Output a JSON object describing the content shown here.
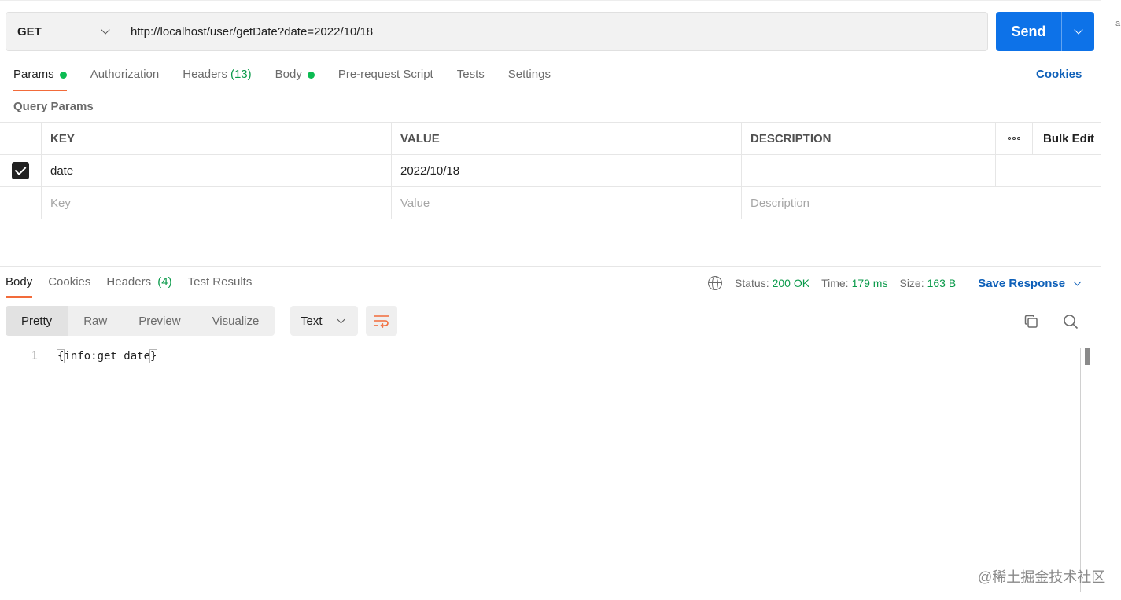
{
  "request": {
    "method": "GET",
    "url": "http://localhost/user/getDate?date=2022/10/18",
    "send_label": "Send"
  },
  "req_tabs": {
    "params": "Params",
    "authorization": "Authorization",
    "headers": "Headers",
    "headers_count": "(13)",
    "body": "Body",
    "pre_request": "Pre-request Script",
    "tests": "Tests",
    "settings": "Settings"
  },
  "cookies_label": "Cookies",
  "query_params_title": "Query Params",
  "params_table": {
    "headers": {
      "key": "KEY",
      "value": "VALUE",
      "description": "DESCRIPTION",
      "bulk_edit": "Bulk Edit"
    },
    "rows": [
      {
        "checked": true,
        "key": "date",
        "value": "2022/10/18",
        "description": ""
      }
    ],
    "placeholders": {
      "key": "Key",
      "value": "Value",
      "description": "Description"
    }
  },
  "response": {
    "tabs": {
      "body": "Body",
      "cookies": "Cookies",
      "headers": "Headers",
      "headers_count": "(4)",
      "test_results": "Test Results"
    },
    "status_label": "Status:",
    "status_value": "200 OK",
    "time_label": "Time:",
    "time_value": "179 ms",
    "size_label": "Size:",
    "size_value": "163 B",
    "save_response": "Save Response",
    "formats": {
      "pretty": "Pretty",
      "raw": "Raw",
      "preview": "Preview",
      "visualize": "Visualize"
    },
    "content_type": "Text",
    "body_lines": [
      {
        "number": "1",
        "open": "{",
        "text": "info:get date",
        "close": "}"
      }
    ]
  },
  "watermark": "@稀土掘金技术社区",
  "edge_glyph": "a",
  "colors": {
    "send_blue": "#0d72e8",
    "active_tab": "#f26b3a",
    "status_green": "#0a9a4a",
    "link_blue": "#0d5fb8"
  },
  "icons": [
    "chevron-down-icon",
    "checkbox-checked-icon",
    "more-dots-icon",
    "globe-icon",
    "wrap-lines-icon",
    "copy-icon",
    "search-icon"
  ]
}
